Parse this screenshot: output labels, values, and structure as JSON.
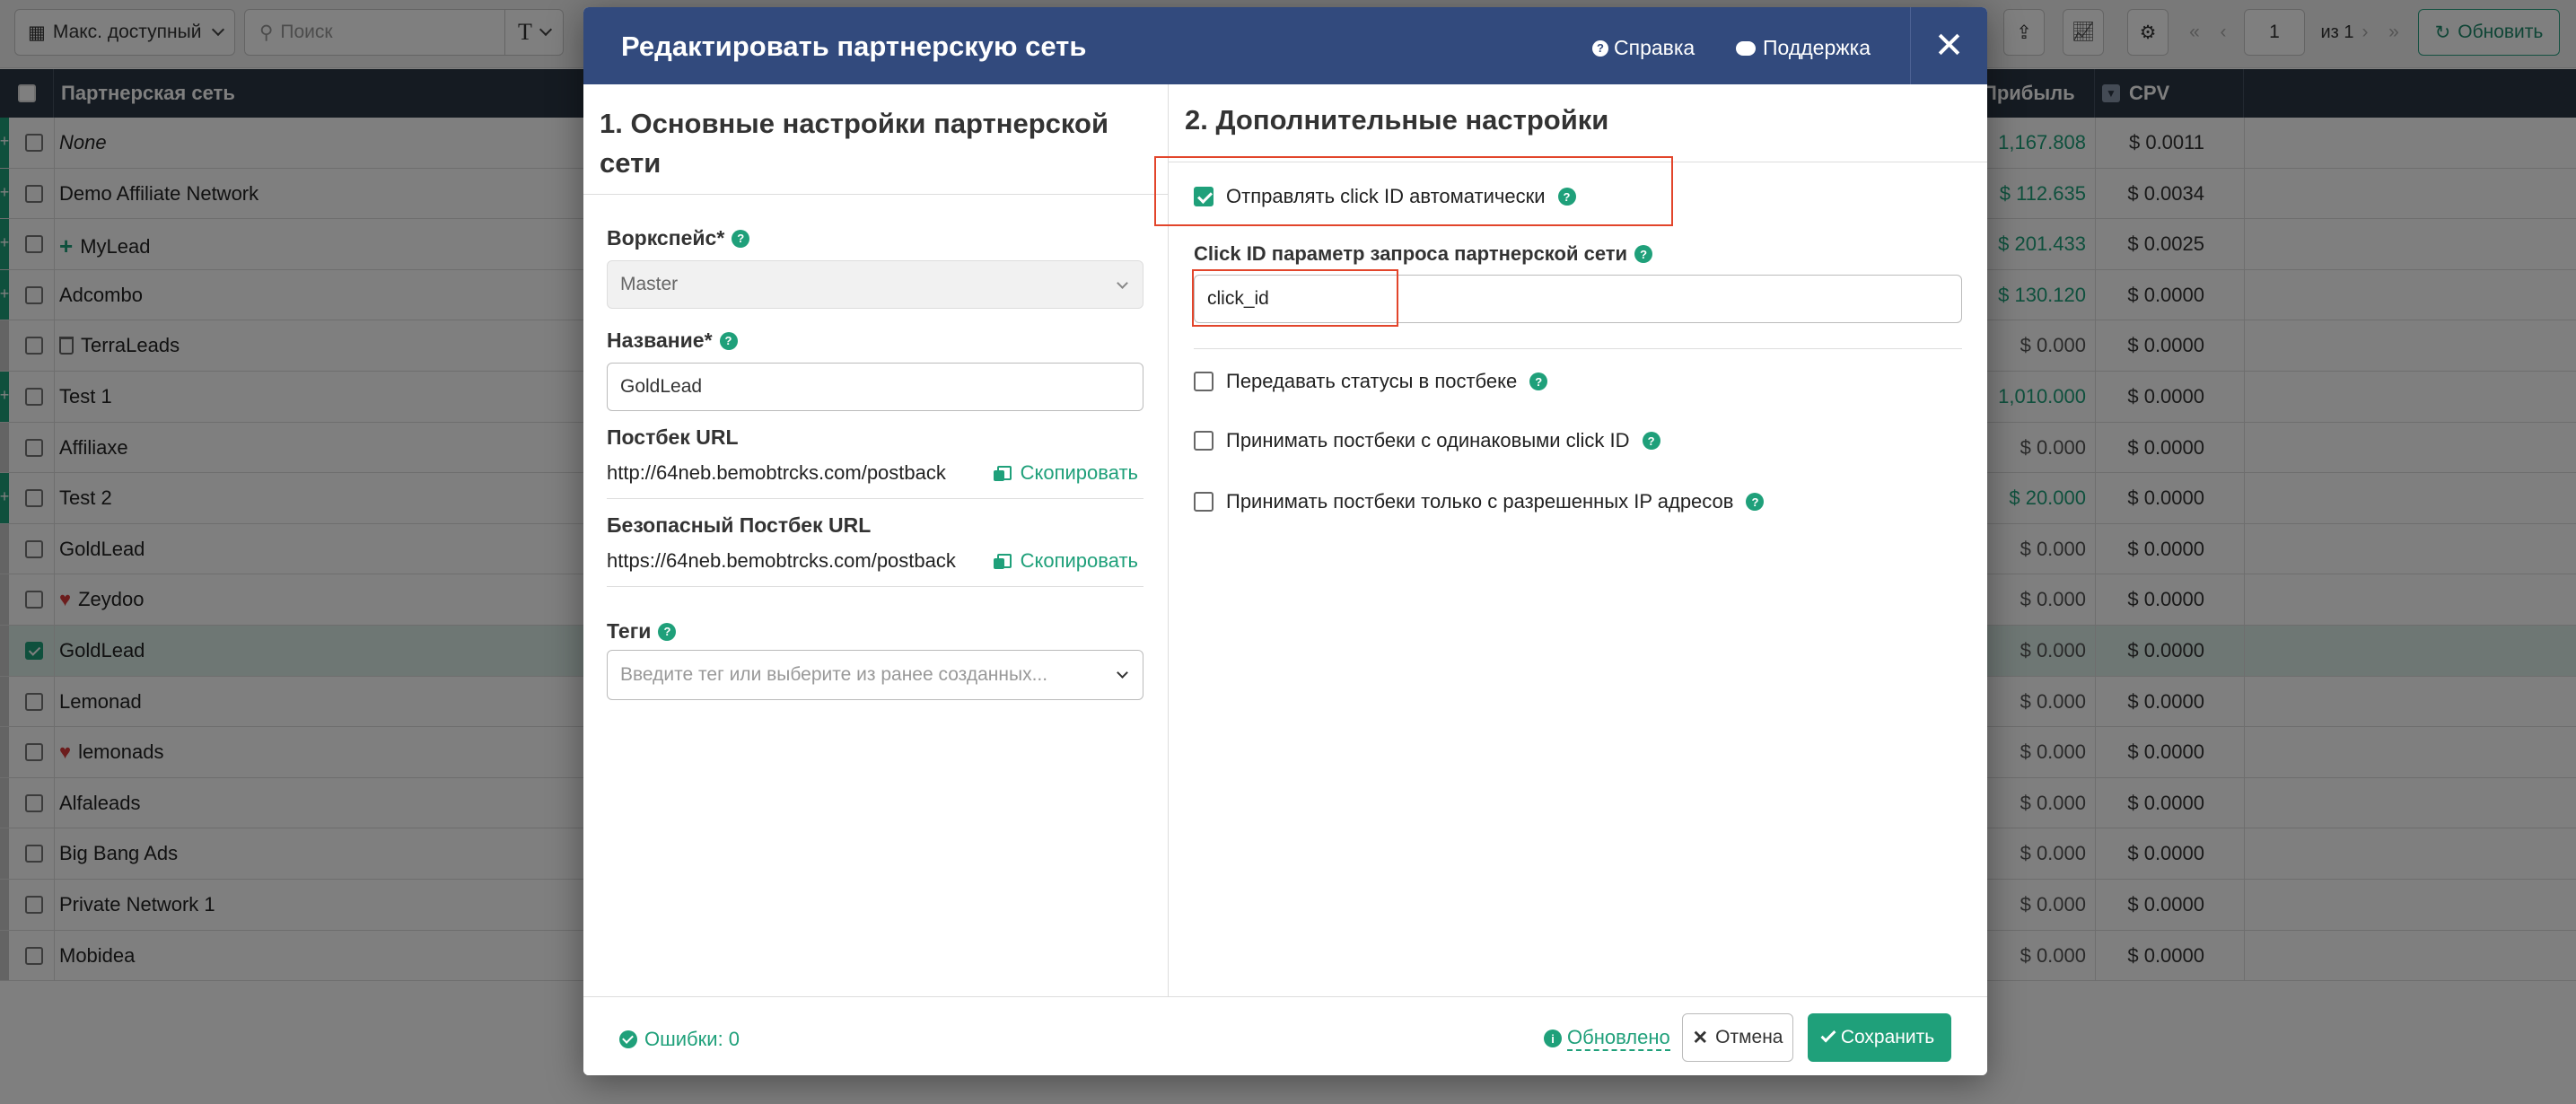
{
  "toolbar": {
    "period_label": "Макс. доступный",
    "search_placeholder": "Поиск",
    "type_label": "T",
    "page_value": "1",
    "page_of": "из 1",
    "refresh_label": "Обновить"
  },
  "table": {
    "columns": {
      "name": "Партнерская сеть",
      "profit": "Прибыль",
      "cpv": "CPV"
    },
    "rows": [
      {
        "name": "None",
        "profit": "1,167.808",
        "cpv": "$ 0.0011",
        "profit_green": true,
        "strip": "green",
        "plus": true,
        "italic": true,
        "icon": ""
      },
      {
        "name": "Demo Affiliate Network",
        "profit": "$ 112.635",
        "cpv": "$ 0.0034",
        "profit_green": true,
        "strip": "green",
        "plus": true,
        "italic": false,
        "icon": ""
      },
      {
        "name": "MyLead",
        "profit": "$ 201.433",
        "cpv": "$ 0.0025",
        "profit_green": true,
        "strip": "green",
        "plus": true,
        "italic": false,
        "icon": "plus-icon"
      },
      {
        "name": "Adcombo",
        "profit": "$ 130.120",
        "cpv": "$ 0.0000",
        "profit_green": true,
        "strip": "green",
        "plus": true,
        "italic": false,
        "icon": ""
      },
      {
        "name": "TerraLeads",
        "profit": "$ 0.000",
        "cpv": "$ 0.0000",
        "profit_green": false,
        "strip": "grey",
        "plus": false,
        "italic": false,
        "icon": "trash-icon"
      },
      {
        "name": "Test 1",
        "profit": "1,010.000",
        "cpv": "$ 0.0000",
        "profit_green": true,
        "strip": "green",
        "plus": true,
        "italic": false,
        "icon": ""
      },
      {
        "name": "Affiliaxe",
        "profit": "$ 0.000",
        "cpv": "$ 0.0000",
        "profit_green": false,
        "strip": "grey",
        "plus": false,
        "italic": false,
        "icon": ""
      },
      {
        "name": "Test 2",
        "profit": "$ 20.000",
        "cpv": "$ 0.0000",
        "profit_green": true,
        "strip": "green",
        "plus": true,
        "italic": false,
        "icon": ""
      },
      {
        "name": "GoldLead",
        "profit": "$ 0.000",
        "cpv": "$ 0.0000",
        "profit_green": false,
        "strip": "grey",
        "plus": false,
        "italic": false,
        "icon": ""
      },
      {
        "name": "Zeydoo",
        "profit": "$ 0.000",
        "cpv": "$ 0.0000",
        "profit_green": false,
        "strip": "grey",
        "plus": false,
        "italic": false,
        "icon": "heart-icon"
      },
      {
        "name": "GoldLead",
        "profit": "$ 0.000",
        "cpv": "$ 0.0000",
        "profit_green": false,
        "strip": "grey",
        "plus": false,
        "italic": false,
        "icon": "",
        "selected": true
      },
      {
        "name": "Lemonad",
        "profit": "$ 0.000",
        "cpv": "$ 0.0000",
        "profit_green": false,
        "strip": "grey",
        "plus": false,
        "italic": false,
        "icon": ""
      },
      {
        "name": "lemonads",
        "profit": "$ 0.000",
        "cpv": "$ 0.0000",
        "profit_green": false,
        "strip": "grey",
        "plus": false,
        "italic": false,
        "icon": "heart-icon"
      },
      {
        "name": "Alfaleads",
        "profit": "$ 0.000",
        "cpv": "$ 0.0000",
        "profit_green": false,
        "strip": "grey",
        "plus": false,
        "italic": false,
        "icon": ""
      },
      {
        "name": "Big Bang Ads",
        "profit": "$ 0.000",
        "cpv": "$ 0.0000",
        "profit_green": false,
        "strip": "grey",
        "plus": false,
        "italic": false,
        "icon": ""
      },
      {
        "name": "Private Network 1",
        "profit": "$ 0.000",
        "cpv": "$ 0.0000",
        "profit_green": false,
        "strip": "grey",
        "plus": false,
        "italic": false,
        "icon": ""
      },
      {
        "name": "Mobidea",
        "profit": "$ 0.000",
        "cpv": "$ 0.0000",
        "profit_green": false,
        "strip": "grey",
        "plus": false,
        "italic": false,
        "icon": ""
      }
    ]
  },
  "modal": {
    "title": "Редактировать партнерскую сеть",
    "help_label": "Справка",
    "support_label": "Поддержка",
    "close_label": "✕",
    "left": {
      "heading": "1. Основные настройки партнерской сети",
      "workspace_label": "Воркспейс*",
      "workspace_value": "Master",
      "name_label": "Название*",
      "name_value": "GoldLead",
      "postback_label": "Постбек URL",
      "postback_value": "http://64neb.bemobtrcks.com/postback",
      "secure_postback_label": "Безопасный Постбек URL",
      "secure_postback_value": "https://64neb.bemobtrcks.com/postback",
      "copy_label": "Скопировать",
      "tags_label": "Теги",
      "tags_placeholder": "Введите тег или выберите из ранее созданных..."
    },
    "right": {
      "heading": "2. Дополнительные настройки",
      "auto_clickid_label": "Отправлять click ID автоматически",
      "auto_clickid_checked": true,
      "clickid_param_label": "Click ID параметр запроса партнерской сети",
      "clickid_param_value": "click_id",
      "pass_statuses_label": "Передавать статусы в постбеке",
      "accept_same_label": "Принимать постбеки с одинаковыми click ID",
      "accept_ip_label": "Принимать постбеки только с разрешенных IP адресов"
    },
    "footer": {
      "errors_label": "Ошибки: 0",
      "updated_label": "Обновлено",
      "cancel_label": "Отмена",
      "save_label": "Сохранить"
    }
  },
  "colors": {
    "header_bg": "#324a7d",
    "accent": "#1fa07a",
    "table_head": "#2b3644",
    "highlight": "#e2452b"
  }
}
